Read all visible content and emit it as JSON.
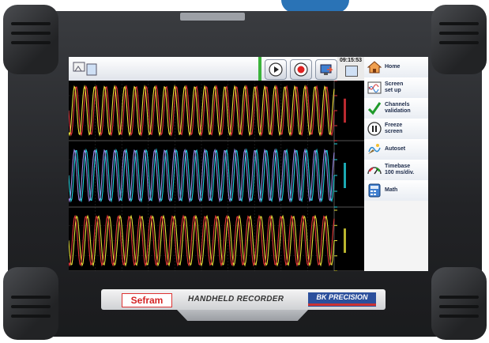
{
  "header": {
    "clock": "09:15:53"
  },
  "toolbar": {
    "file_icon": "folder-icon",
    "play_icon": "play-icon",
    "record_icon": "record-icon",
    "export_icon": "export-icon"
  },
  "menu": {
    "items": [
      {
        "label": "Home",
        "icon": "home-icon"
      },
      {
        "label": "Screen\nset up",
        "icon": "screen-setup-icon"
      },
      {
        "label": "Channels\nvalidation",
        "icon": "checkmark-icon"
      },
      {
        "label": "Freeze\nscreen",
        "icon": "pause-icon"
      },
      {
        "label": "Autoset",
        "icon": "autoset-icon"
      },
      {
        "label": "Timebase\n100 ms/div.",
        "icon": "timebase-gauge-icon"
      },
      {
        "label": "Math",
        "icon": "calculator-icon"
      }
    ]
  },
  "traces": {
    "channels": [
      {
        "row": 0,
        "color": "#e8343c",
        "cycles": 26.5,
        "amplitude": 0.9
      },
      {
        "row": 0,
        "color": "#f2e23a",
        "cycles": 26.5,
        "amplitude": 0.9
      },
      {
        "row": 1,
        "color": "#22d3e0",
        "cycles": 26.5,
        "amplitude": 0.9
      },
      {
        "row": 1,
        "color": "#9b8be8",
        "cycles": 26.5,
        "amplitude": 0.9
      },
      {
        "row": 2,
        "color": "#e8e23a",
        "cycles": 24.5,
        "amplitude": 0.9
      },
      {
        "row": 2,
        "color": "#e83838",
        "cycles": 24.5,
        "amplitude": 0.9
      }
    ],
    "colors": {
      "grid": "#2a2a2a",
      "background": "#000000"
    }
  },
  "plate": {
    "brand_left": "Sefram",
    "title": "HANDHELD RECORDER",
    "brand_right": "BK PRECISION"
  },
  "colors": {
    "accent": "#2a73b6",
    "menu_text": "#1d2b4a",
    "brand_red": "#d42424",
    "brand_blue": "#2b4f9c"
  }
}
